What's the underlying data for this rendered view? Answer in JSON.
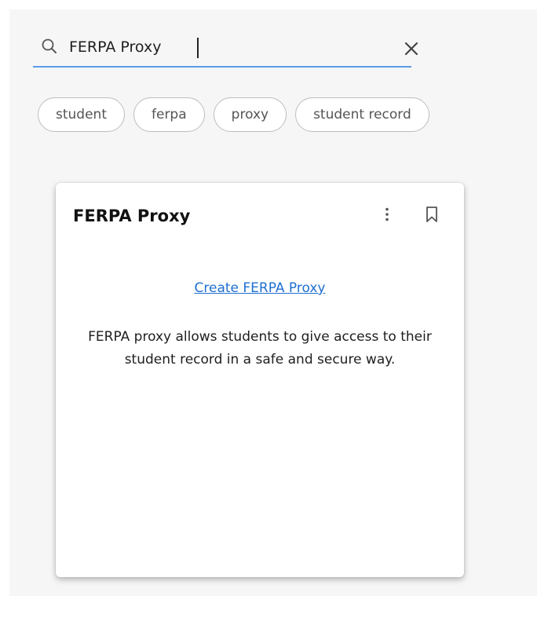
{
  "search": {
    "query": "FERPA Proxy",
    "icon": "search-icon",
    "clear_icon": "close-icon"
  },
  "chips": [
    {
      "label": "student"
    },
    {
      "label": "ferpa"
    },
    {
      "label": "proxy"
    },
    {
      "label": "student record"
    }
  ],
  "card": {
    "title": "FERPA Proxy",
    "more_icon": "more-vertical-icon",
    "bookmark_icon": "bookmark-icon",
    "link_text": "Create FERPA Proxy",
    "description": "FERPA proxy allows students to give access to their student record in a safe and secure way."
  },
  "colors": {
    "accent": "#5b9bea",
    "link": "#1f6fd1",
    "background": "#f6f6f6"
  }
}
